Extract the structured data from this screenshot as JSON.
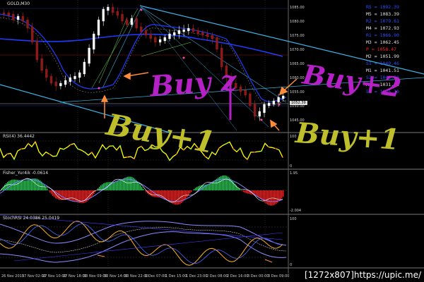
{
  "panes": {
    "main": {
      "title": "GOLD,M30"
    },
    "rsi": {
      "title": "RSI(4) 36.4442",
      "scale": [
        "100",
        "0"
      ]
    },
    "fisher": {
      "title": "Fisher_Yur4ik -0.0614",
      "scale": [
        "1.95",
        "-2.004"
      ]
    },
    "stoch": {
      "title": "StochRSI 24.0386 25.0419",
      "scale": [
        "100",
        "0"
      ]
    }
  },
  "levels": [
    {
      "label": "R5 = 1092.39",
      "color": "#3050ff"
    },
    {
      "label": "M5 = 1083.39",
      "color": "#e0e0e0"
    },
    {
      "label": "R2 = 1079.61",
      "color": "#3050ff"
    },
    {
      "label": "M4 = 1072.93",
      "color": "#e0e0e0"
    },
    {
      "label": "R1 = 1066.90",
      "color": "#3050ff"
    },
    {
      "label": "M3 = 1062.45",
      "color": "#e0e0e0"
    },
    {
      "label": "P  = 1058.47",
      "color": "#ff2020"
    },
    {
      "label": "M2 = 1051.99",
      "color": "#e0e0e0"
    },
    {
      "label": "S1 = 1049.46",
      "color": "#3050ff"
    },
    {
      "label": "M1 = 1041.51",
      "color": "#e0e0e0"
    },
    {
      "label": "S2 = 1040.50",
      "color": "#3050ff"
    },
    {
      "label": "M0 = 1031.05",
      "color": "#e0e0e0"
    },
    {
      "label": "S3 = 1025.10",
      "color": "#3050ff"
    }
  ],
  "price_scale": [
    "1085.00",
    "1080.00",
    "1075.00",
    "1070.00",
    "1065.00",
    "1060.00",
    "1055.00",
    "1050.00",
    "1045.00"
  ],
  "current_price": "1052.39",
  "time_axis": [
    "26 Nov 2015",
    "27 Nov 02:00",
    "27 Nov 10:00",
    "27 Nov 18:00",
    "30 Nov 09:00",
    "30 Nov 14:00",
    "30 Nov 22:00",
    "1 Dec 07:00",
    "1 Dec 15:00",
    "1 Dec 23:00",
    "2 Dec 08:00",
    "2 Dec 16:00",
    "3 Dec 00:00",
    "3 Dec 09:00"
  ],
  "annotations": {
    "buy_z": "Buy z",
    "buy_2": "Buy+2",
    "buy_1_left": "Buy+1",
    "buy_1_right": "Buy+1"
  },
  "colors": {
    "background": "#000000",
    "bull_candle": "#ffffff",
    "bear_candle": "#8b1a1a",
    "channel": "#3cb4e6",
    "ma_blue": "#1e3cff",
    "rsi_line": "#ffff00",
    "fisher_green": "#1fd25a",
    "fisher_red": "#ff1e1e",
    "annotation_purple": "#b521c6",
    "annotation_olive": "#bfbf2b",
    "arrow_orange": "#ff8c3a"
  },
  "watermark": "[1272x807]https://upic.me/"
}
